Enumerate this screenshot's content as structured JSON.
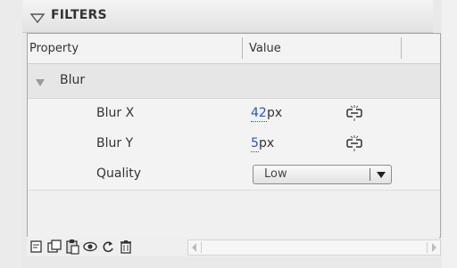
{
  "panel": {
    "title": "FILTERS"
  },
  "table": {
    "headers": {
      "property": "Property",
      "value": "Value"
    },
    "group": {
      "label": "Blur",
      "expanded": true
    },
    "rows": [
      {
        "label": "Blur X",
        "value": "42",
        "unit": "px",
        "icon": "link-constrain-icon"
      },
      {
        "label": "Blur Y",
        "value": "5",
        "unit": "px",
        "icon": "link-constrain-icon"
      },
      {
        "label": "Quality",
        "select_value": "Low"
      }
    ]
  },
  "toolbar": {
    "buttons": [
      "add-filter-icon",
      "duplicate-filter-icon",
      "paste-filter-icon",
      "toggle-visibility-icon",
      "reset-filter-icon",
      "delete-filter-icon"
    ]
  },
  "colors": {
    "value_link": "#2255cc"
  }
}
